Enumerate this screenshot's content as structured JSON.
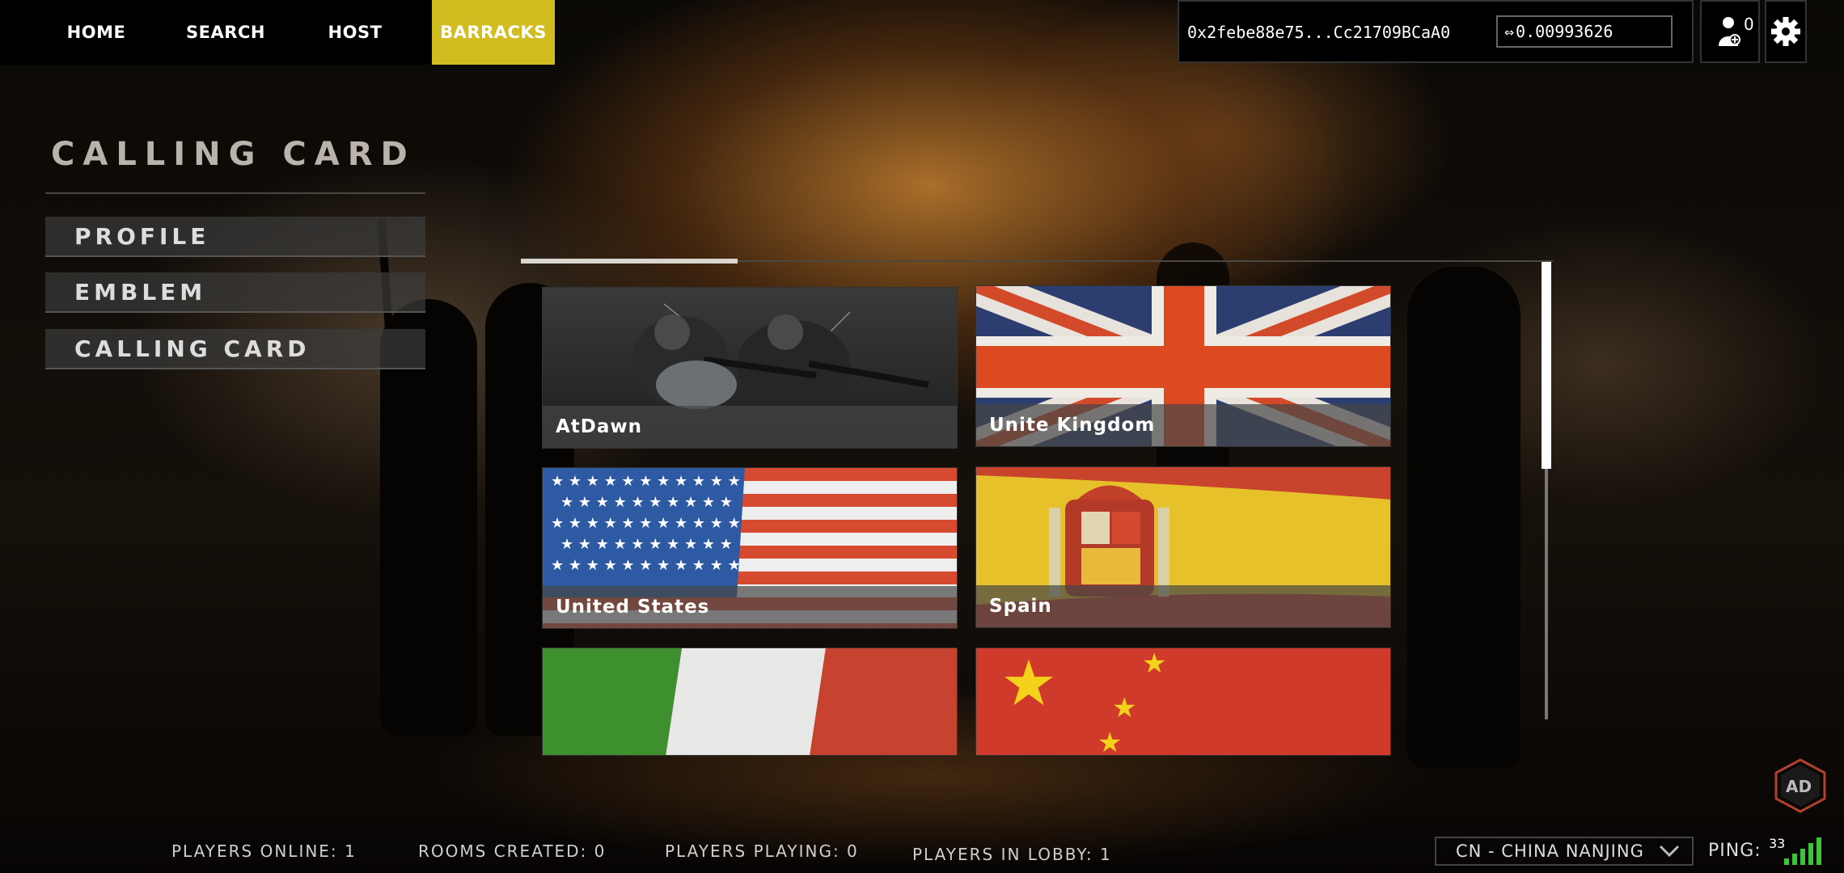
{
  "nav": {
    "items": [
      {
        "label": "HOME"
      },
      {
        "label": "SEARCH"
      },
      {
        "label": "HOST"
      },
      {
        "label": "BARRACKS",
        "active": true
      }
    ],
    "accent": "#d2bd20"
  },
  "wallet": {
    "address": "0x2febe88e75...Cc21709BCaA0",
    "balance": "0.00993626",
    "balance_icon": "transfer-arrows-icon"
  },
  "friends": {
    "count": "0",
    "icon": "user-add-icon"
  },
  "settings": {
    "icon": "gear-icon"
  },
  "section": {
    "title": "CALLING CARD"
  },
  "menu": {
    "items": [
      {
        "label": "PROFILE"
      },
      {
        "label": "EMBLEM"
      },
      {
        "label": "CALLING CARD"
      }
    ]
  },
  "cards": [
    {
      "label": "AtDawn",
      "art": "soldiers"
    },
    {
      "label": "Unite Kingdom",
      "art": "uk-flag"
    },
    {
      "label": "United States",
      "art": "us-flag"
    },
    {
      "label": "Spain",
      "art": "spain-flag"
    },
    {
      "label": "",
      "art": "italy-flag"
    },
    {
      "label": "",
      "art": "china-flag"
    }
  ],
  "footer": {
    "players_online": "PLAYERS ONLINE: 1",
    "rooms_created": "ROOMS CREATED: 0",
    "players_playing": "PLAYERS PLAYING: 0",
    "players_in_lobby": "PLAYERS IN LOBBY: 1",
    "region": "CN - CHINA NANJING",
    "ping_label": "PING:",
    "ping_value": "33",
    "signal_color": "#3cc53a"
  }
}
